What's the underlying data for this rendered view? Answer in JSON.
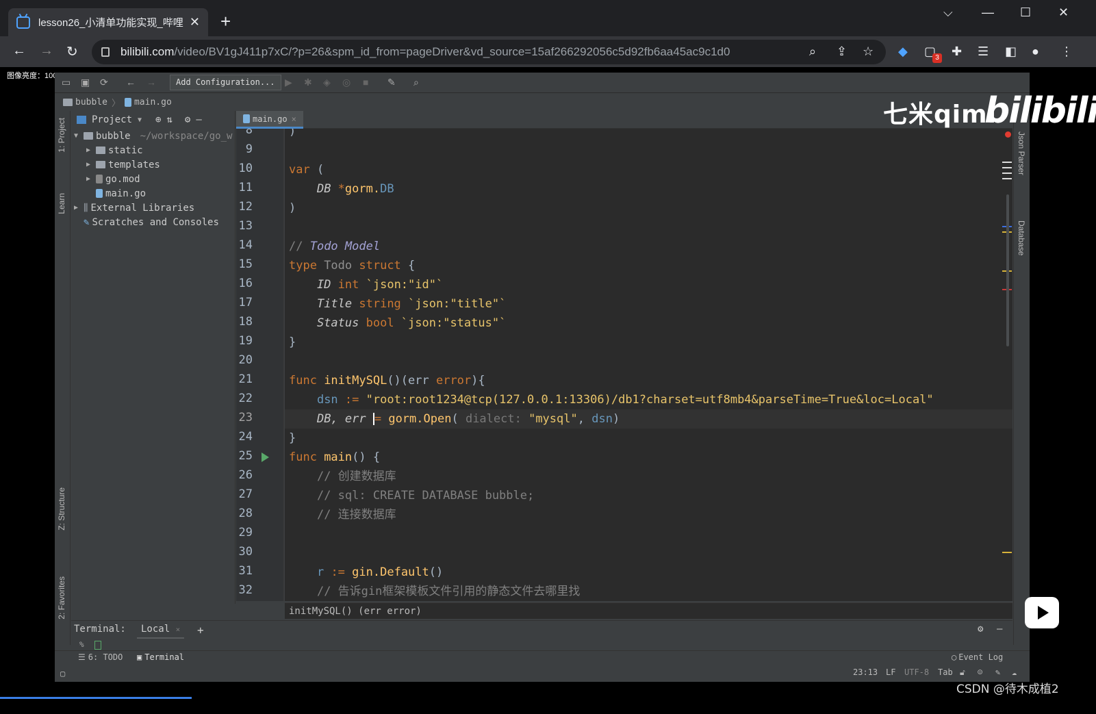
{
  "browser": {
    "tab_title": "lesson26_小清单功能实现_哔哩",
    "tab_close": "✕",
    "new_tab": "+",
    "url_host": "bilibili.com",
    "url_path": "/video/BV1gJ411p7xC/?p=26&spm_id_from=pageDriver&vd_source=15af266292056c5d92fb6aa45ac9c1d0",
    "extension_badge": "3"
  },
  "overlay": {
    "zoom_label": "图像亮度：100%",
    "watermark_text": "七米qimi",
    "bilibili_logo": "bilibili",
    "csdn_credit": "CSDN @待木成植2"
  },
  "ide": {
    "toolbar": {
      "add_config_label": "Add Configuration..."
    },
    "breadcrumbs": [
      "bubble",
      "main.go"
    ],
    "left_tools": [
      "1: Project",
      "Learn",
      "Z: Structure",
      "2: Favorites"
    ],
    "right_tools": [
      "Json Parser",
      "Database"
    ],
    "project": {
      "header": "Project",
      "tree": [
        {
          "label": "bubble",
          "path": "~/workspace/go_w",
          "depth": 0,
          "expanded": true,
          "kind": "folder"
        },
        {
          "label": "static",
          "depth": 1,
          "kind": "folder"
        },
        {
          "label": "templates",
          "depth": 1,
          "kind": "folder"
        },
        {
          "label": "go.mod",
          "depth": 1,
          "kind": "file"
        },
        {
          "label": "main.go",
          "depth": 1,
          "kind": "gofile"
        },
        {
          "label": "External Libraries",
          "depth": 0,
          "kind": "lib"
        },
        {
          "label": "Scratches and Consoles",
          "depth": 0,
          "kind": "scratch"
        }
      ]
    },
    "editor_tab": "main.go",
    "code_hint": "initMySQL() (err error)",
    "terminal": {
      "label": "Terminal:",
      "tab": "Local",
      "prompt": "%"
    },
    "status_tabs": [
      "6: TODO",
      "Terminal"
    ],
    "event_log": "Event Log",
    "status": {
      "position": "23:13",
      "line_sep": "LF",
      "encoding": "UTF-8",
      "indent": "Tab"
    }
  },
  "code": {
    "first_line": 8,
    "current_line": 23,
    "run_line": 25,
    "line_8": ")",
    "line_9": "",
    "line_10_kw": "var",
    "line_10_rest": " (",
    "line_11_name": "DB",
    "line_11_star": " *",
    "line_11_pkg": "gorm.",
    "line_11_type": "DB",
    "line_12": ")",
    "line_13": "",
    "line_14_slash": "// ",
    "line_14_cmt": "Todo Model",
    "line_15_kw": "type",
    "line_15_name": " Todo ",
    "line_15_kw2": "struct",
    "line_15_rest": " {",
    "line_16_field": "ID",
    "line_16_type": " int ",
    "line_16_tag": "`json:\"id\"`",
    "line_17_field": "Title",
    "line_17_type": " string ",
    "line_17_tag": "`json:\"title\"`",
    "line_18_field": "Status",
    "line_18_type": " bool ",
    "line_18_tag": "`json:\"status\"`",
    "line_19": "}",
    "line_20": "",
    "line_21_kw": "func",
    "line_21_fn": " initMySQL",
    "line_21_rest": "()(err ",
    "line_21_type": "error",
    "line_21_end": "){",
    "line_22_var": "dsn",
    "line_22_op": " := ",
    "line_22_str": "\"root:root1234@tcp(127.0.0.1:13306)/db1?charset=utf8mb4&parseTime=True&loc=Local\"",
    "line_23_a": "DB, err ",
    "line_23_op": "= ",
    "line_23_pkg": "gorm.",
    "line_23_fn": "Open",
    "line_23_paren": "( ",
    "line_23_hint": "dialect: ",
    "line_23_str": "\"mysql\"",
    "line_23_comma": ", ",
    "line_23_var": "dsn",
    "line_23_end": ")",
    "line_24": "}",
    "line_25_kw": "func",
    "line_25_fn": " main",
    "line_25_rest": "() {",
    "line_26": "// 创建数据库",
    "line_27": "// sql: CREATE DATABASE bubble;",
    "line_28": "// 连接数据库",
    "line_29": "",
    "line_30": "",
    "line_31_var": "r",
    "line_31_op": " := ",
    "line_31_pkg": "gin.",
    "line_31_fn": "Default",
    "line_31_end": "()",
    "line_32": "// 告诉gin框架模板文件引用的静态文件去哪里找"
  },
  "colors": {
    "keyword": "#cc7832",
    "string": "#e8c46a",
    "comment": "#808080",
    "editor_bg": "#2b2b2b",
    "accent": "#4a88c7",
    "run": "#59a869"
  }
}
